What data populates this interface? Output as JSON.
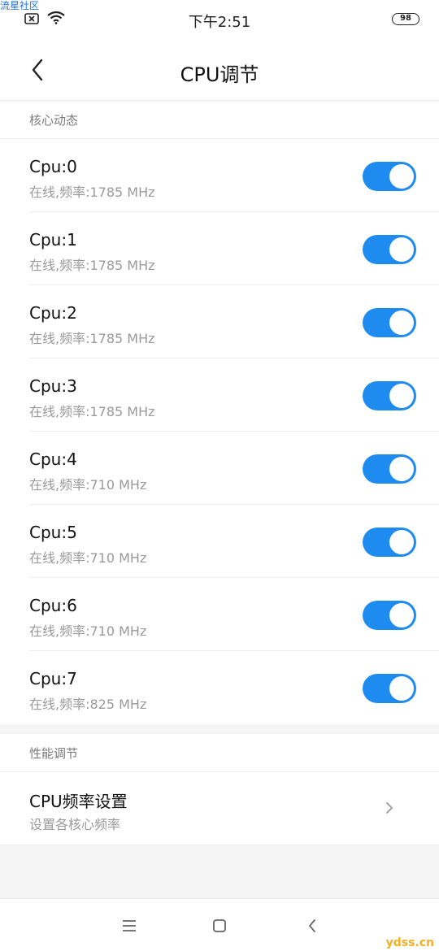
{
  "watermark_top": "流星社区",
  "status_bar": {
    "time": "下午2:51",
    "battery": "98"
  },
  "header": {
    "title": "CPU调节"
  },
  "cores_section": {
    "title": "核心动态",
    "items": [
      {
        "label": "Cpu:0",
        "status": "在线,频率:1785 MHz",
        "enabled": true
      },
      {
        "label": "Cpu:1",
        "status": "在线,频率:1785 MHz",
        "enabled": true
      },
      {
        "label": "Cpu:2",
        "status": "在线,频率:1785 MHz",
        "enabled": true
      },
      {
        "label": "Cpu:3",
        "status": "在线,频率:1785 MHz",
        "enabled": true
      },
      {
        "label": "Cpu:4",
        "status": "在线,频率:710 MHz",
        "enabled": true
      },
      {
        "label": "Cpu:5",
        "status": "在线,频率:710 MHz",
        "enabled": true
      },
      {
        "label": "Cpu:6",
        "status": "在线,频率:710 MHz",
        "enabled": true
      },
      {
        "label": "Cpu:7",
        "status": "在线,频率:825 MHz",
        "enabled": true
      }
    ]
  },
  "perf_section": {
    "title": "性能调节",
    "freq_item": {
      "label": "CPU频率设置",
      "sub": "设置各核心频率"
    }
  },
  "colors": {
    "toggle_on": "#1e8bf0",
    "accent": "#1a73e8"
  },
  "watermark_bottom": "ydss.cn"
}
